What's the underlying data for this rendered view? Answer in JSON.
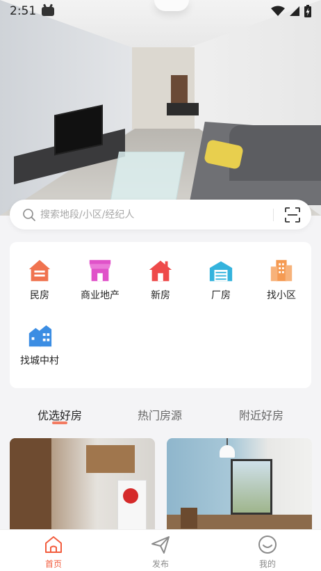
{
  "status_bar": {
    "time": "2:51"
  },
  "search": {
    "placeholder": "搜索地段/小区/经纪人"
  },
  "categories": [
    {
      "label": "民房",
      "icon": "house-icon"
    },
    {
      "label": "商业地产",
      "icon": "shop-icon"
    },
    {
      "label": "新房",
      "icon": "new-house-icon"
    },
    {
      "label": "厂房",
      "icon": "factory-icon"
    },
    {
      "label": "找小区",
      "icon": "building-icon"
    },
    {
      "label": "找城中村",
      "icon": "village-icon"
    }
  ],
  "tabs": [
    {
      "label": "优选好房",
      "active": true
    },
    {
      "label": "热门房源",
      "active": false
    },
    {
      "label": "附近好房",
      "active": false
    }
  ],
  "bottom_nav": [
    {
      "label": "首页",
      "icon": "home-icon",
      "active": true
    },
    {
      "label": "发布",
      "icon": "send-icon",
      "active": false
    },
    {
      "label": "我的",
      "icon": "smile-icon",
      "active": false
    }
  ],
  "colors": {
    "accent": "#f25c3d",
    "house": "#f0734f",
    "shop": "#e052c9",
    "new_house": "#ee4a4a",
    "factory": "#34b3dd",
    "building": "#f59a52",
    "village": "#3b8de3"
  }
}
